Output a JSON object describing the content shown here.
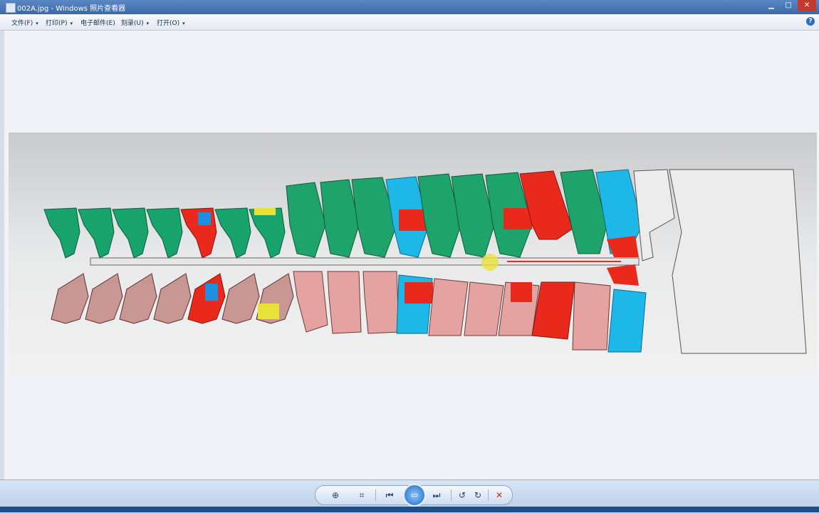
{
  "window": {
    "title": "002A.jpg - Windows 照片查看器",
    "caption_buttons": [
      "minimize-icon",
      "maximize-icon",
      "close-icon"
    ]
  },
  "menu": {
    "items": [
      {
        "label": "文件(F)",
        "name": "menu-file"
      },
      {
        "label": "打印(P)",
        "name": "menu-print"
      },
      {
        "label": "电子邮件(E)",
        "name": "menu-email"
      },
      {
        "label": "刻录(U)",
        "name": "menu-burn"
      },
      {
        "label": "打开(O)",
        "name": "menu-open"
      }
    ],
    "dropdown_arrow": "▾",
    "help": "?"
  },
  "toolbar": {
    "zoom": "⊕",
    "actual_size": "⌗",
    "previous": "⏮",
    "slideshow": "▭",
    "next": "⏭",
    "rotate_ccw": "↺",
    "rotate_cw": "↻",
    "delete": "✕"
  },
  "image": {
    "description_colors": [
      "#1ea36b",
      "#e8291c",
      "#1db7e8",
      "#e8e13a",
      "#d9a3a0",
      "#c7c7c7"
    ]
  }
}
